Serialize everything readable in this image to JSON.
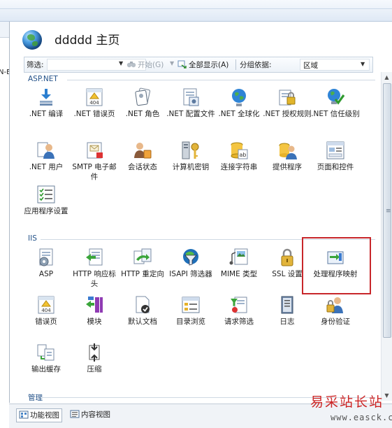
{
  "page": {
    "title": "ddddd 主页"
  },
  "left_pane": {
    "clipped_text": "N-E"
  },
  "toolbar": {
    "filter_label": "筛选:",
    "start_label": "开始(G)",
    "show_all_label": "全部显示(A)",
    "group_by_label": "分组依据:",
    "group_by_value": "区域"
  },
  "groups": [
    {
      "name": "ASP.NET",
      "items": [
        {
          "label": ".NET 编译",
          "icon": "net-compile-icon"
        },
        {
          "label": ".NET 错误页",
          "icon": "net-error-page-icon"
        },
        {
          "label": ".NET 角色",
          "icon": "net-roles-icon"
        },
        {
          "label": ".NET 配置文件",
          "icon": "net-profile-icon"
        },
        {
          "label": ".NET 全球化",
          "icon": "net-globalization-icon"
        },
        {
          "label": ".NET 授权规则",
          "icon": "net-authorization-icon"
        },
        {
          "label": ".NET 信任级别",
          "icon": "net-trust-levels-icon"
        },
        {
          "label": ".NET 用户",
          "icon": "net-users-icon"
        },
        {
          "label": "SMTP 电子邮件",
          "icon": "smtp-email-icon"
        },
        {
          "label": "会话状态",
          "icon": "session-state-icon"
        },
        {
          "label": "计算机密钥",
          "icon": "machine-key-icon"
        },
        {
          "label": "连接字符串",
          "icon": "connection-strings-icon"
        },
        {
          "label": "提供程序",
          "icon": "providers-icon"
        },
        {
          "label": "页面和控件",
          "icon": "pages-controls-icon"
        },
        {
          "label": "应用程序设置",
          "icon": "app-settings-icon"
        }
      ]
    },
    {
      "name": "IIS",
      "items": [
        {
          "label": "ASP",
          "icon": "asp-icon"
        },
        {
          "label": "HTTP 响应标头",
          "icon": "http-response-headers-icon"
        },
        {
          "label": "HTTP 重定向",
          "icon": "http-redirect-icon"
        },
        {
          "label": "ISAPI 筛选器",
          "icon": "isapi-filters-icon"
        },
        {
          "label": "MIME 类型",
          "icon": "mime-types-icon"
        },
        {
          "label": "SSL 设置",
          "icon": "ssl-settings-icon"
        },
        {
          "label": "处理程序映射",
          "icon": "handler-mappings-icon"
        },
        {
          "label": "错误页",
          "icon": "error-pages-icon"
        },
        {
          "label": "模块",
          "icon": "modules-icon"
        },
        {
          "label": "默认文档",
          "icon": "default-document-icon"
        },
        {
          "label": "目录浏览",
          "icon": "directory-browsing-icon"
        },
        {
          "label": "请求筛选",
          "icon": "request-filtering-icon"
        },
        {
          "label": "日志",
          "icon": "logging-icon"
        },
        {
          "label": "身份验证",
          "icon": "authentication-icon"
        },
        {
          "label": "输出缓存",
          "icon": "output-caching-icon"
        },
        {
          "label": "压缩",
          "icon": "compression-icon"
        }
      ]
    },
    {
      "name": "管理",
      "items": []
    }
  ],
  "bottom_tabs": {
    "features_view": "功能视图",
    "content_view": "内容视图"
  },
  "watermark": {
    "text_cn": "易采站长站",
    "text_url": "www.easck.com"
  },
  "colors": {
    "highlight": "#c8262a",
    "group_header": "#245289"
  }
}
